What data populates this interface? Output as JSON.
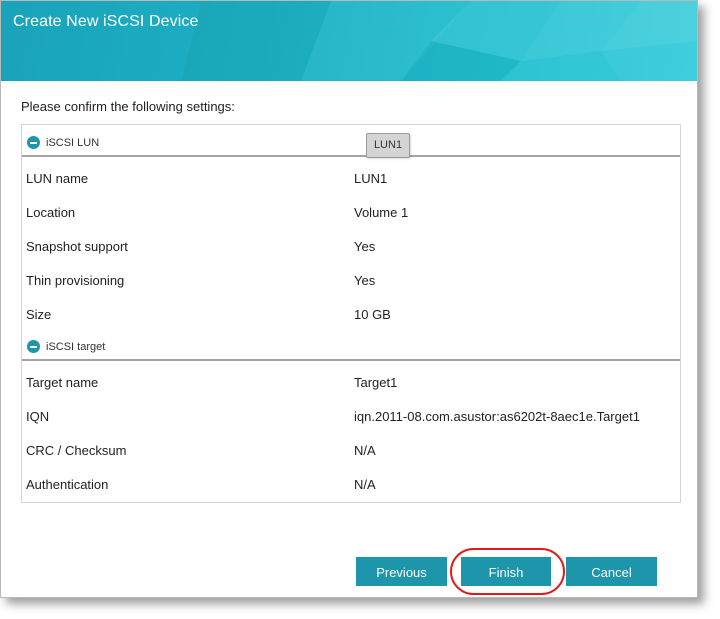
{
  "window": {
    "title": "Create New iSCSI Device"
  },
  "confirm_text": "Please confirm the following settings:",
  "tooltip": "LUN1",
  "sections": [
    {
      "label": "iSCSI LUN",
      "rows": [
        {
          "key": "LUN name",
          "value": "LUN1"
        },
        {
          "key": "Location",
          "value": "Volume 1"
        },
        {
          "key": "Snapshot support",
          "value": "Yes"
        },
        {
          "key": "Thin provisioning",
          "value": "Yes"
        },
        {
          "key": "Size",
          "value": "10 GB"
        }
      ]
    },
    {
      "label": "iSCSI target",
      "rows": [
        {
          "key": "Target name",
          "value": "Target1"
        },
        {
          "key": "IQN",
          "value": "iqn.2011-08.com.asustor:as6202t-8aec1e.Target1"
        },
        {
          "key": "CRC / Checksum",
          "value": "N/A"
        },
        {
          "key": "Authentication",
          "value": "N/A"
        }
      ]
    }
  ],
  "buttons": {
    "previous": "Previous",
    "finish": "Finish",
    "cancel": "Cancel"
  },
  "colors": {
    "accent": "#1d95ab",
    "header_gradient_start": "#1aa3bb",
    "header_gradient_end": "#2ac9d8",
    "highlight_ring": "#e01a1a"
  }
}
